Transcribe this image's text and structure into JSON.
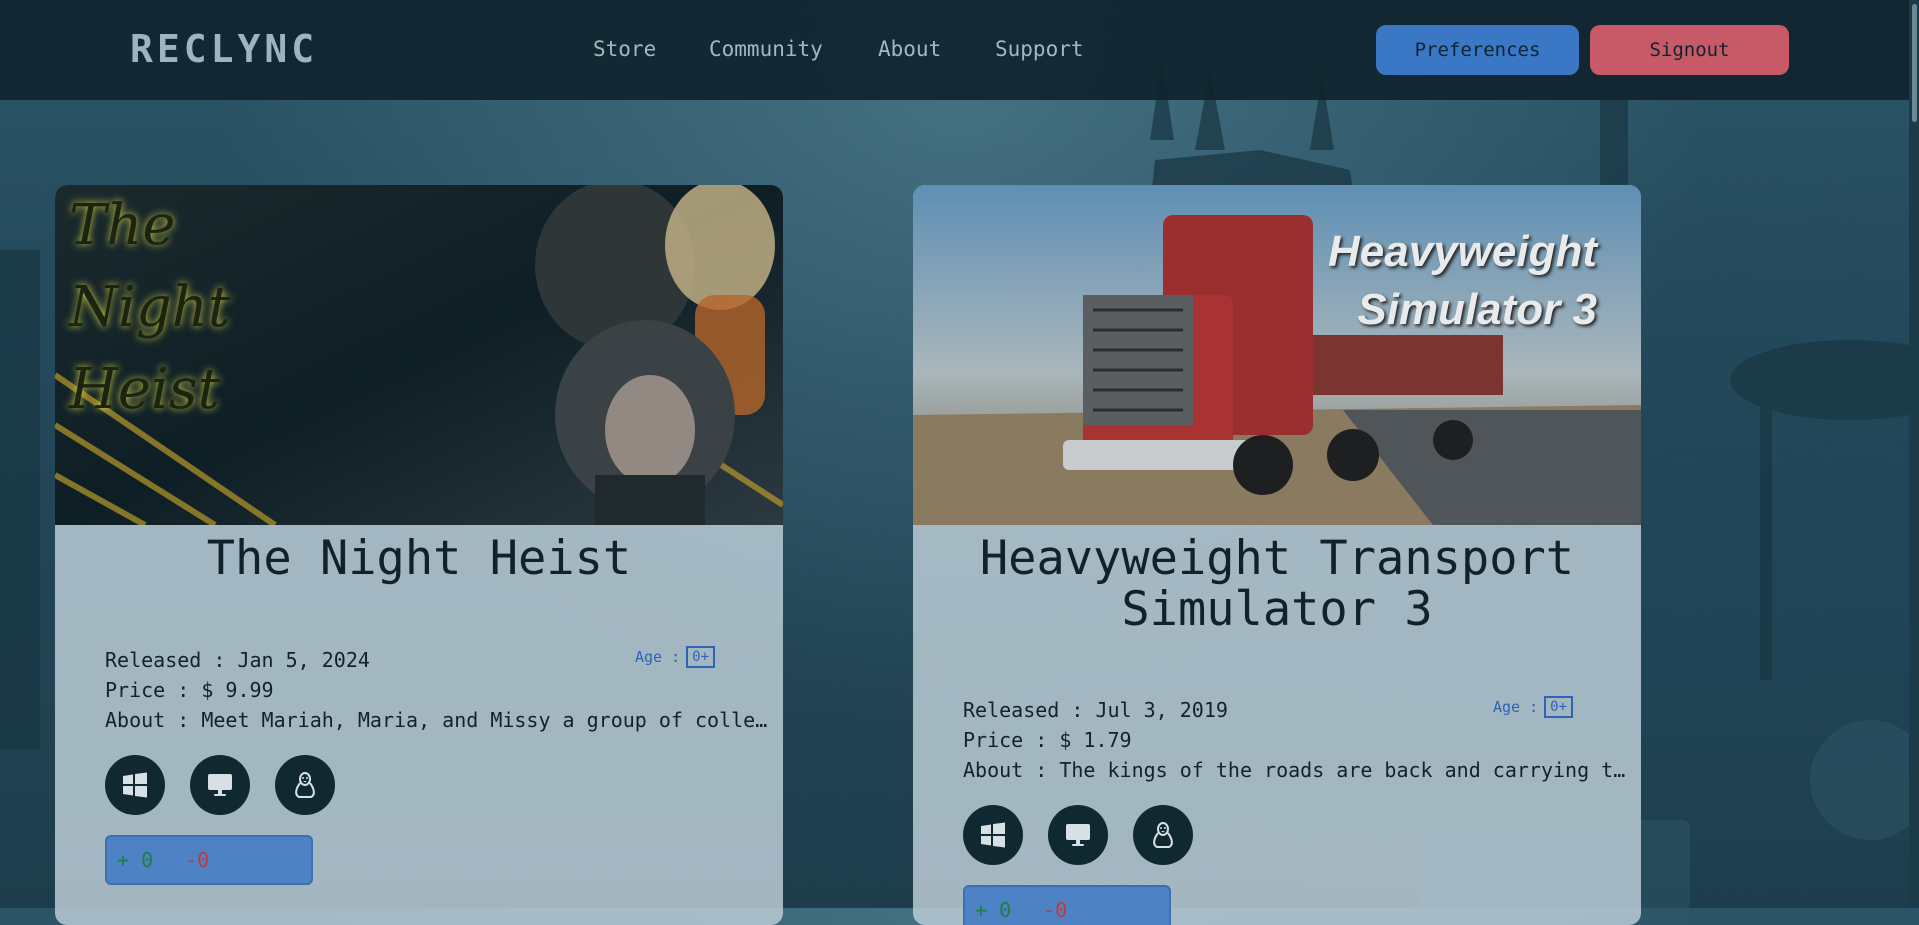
{
  "brand": "RECLYNC",
  "nav": {
    "links": [
      "Store",
      "Community",
      "About",
      "Support"
    ],
    "preferences_label": "Preferences",
    "signout_label": "Signout"
  },
  "games": [
    {
      "cover_text": [
        "The",
        "Night",
        "Heist"
      ],
      "title": "The Night Heist",
      "released": "Released : Jan 5, 2024",
      "price": "Price : $ 9.99",
      "about": "About : Meet Mariah, Maria, and Missy a group of colle…",
      "age_label": "Age :",
      "age_value": "0+",
      "platforms": [
        "windows-icon",
        "desktop-icon",
        "linux-icon"
      ],
      "upvotes": "+ 0",
      "downvotes": "-0"
    },
    {
      "cover_text": [
        "Heavyweight",
        "Simulator 3"
      ],
      "title": "Heavyweight Transport Simulator 3",
      "released": "Released : Jul 3, 2019",
      "price": "Price : $ 1.79",
      "about": "About : The kings of the roads are back and carrying t…",
      "age_label": "Age :",
      "age_value": "0+",
      "platforms": [
        "windows-icon",
        "desktop-icon",
        "linux-icon"
      ],
      "upvotes": "+ 0",
      "downvotes": "-0"
    }
  ],
  "colors": {
    "navbar": "#10242d",
    "preferences": "#3a78c6",
    "signout": "#c65a66",
    "age_accent": "#2f64b4",
    "upvote": "#1f7d40",
    "downvote": "#c03840"
  }
}
